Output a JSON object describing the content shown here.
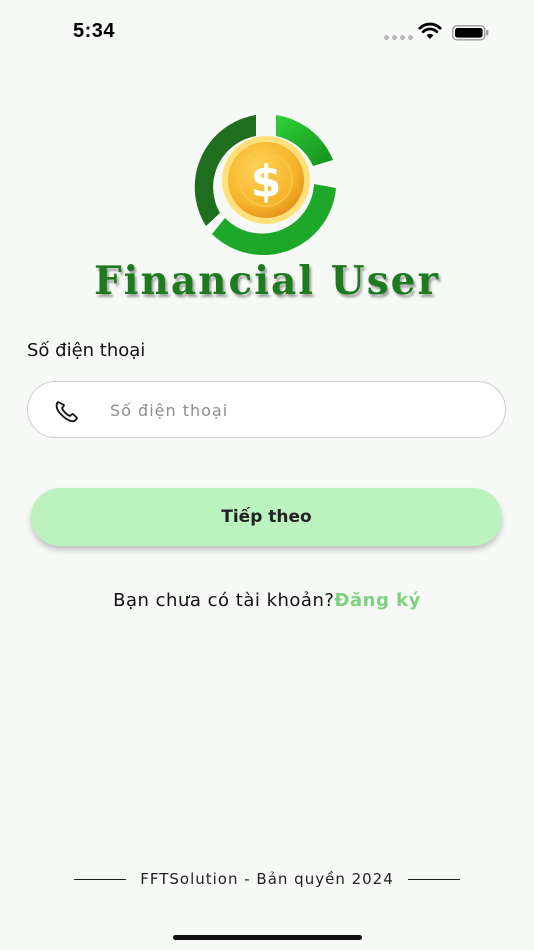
{
  "status_bar": {
    "time": "5:34"
  },
  "app": {
    "title": "Financial User",
    "logo_symbol": "$",
    "colors": {
      "brand_green": "#1e7a1e",
      "accent_green": "#7fd07f",
      "button_bg": "#bcf2bf",
      "coin_gold": "#f4b52c"
    }
  },
  "login": {
    "phone_label": "Số điện thoại",
    "phone_placeholder": "Số điện thoại",
    "phone_value": "",
    "next_button": "Tiếp theo",
    "no_account_text": "Bạn chưa có tài khoản?",
    "signup_link": "Đăng ký"
  },
  "footer": {
    "text": "FFTSolution - Bản quyền 2024"
  },
  "icons": {
    "phone": "phone-icon",
    "wifi": "wifi-icon",
    "battery": "battery-icon",
    "signal": "signal-icon"
  }
}
